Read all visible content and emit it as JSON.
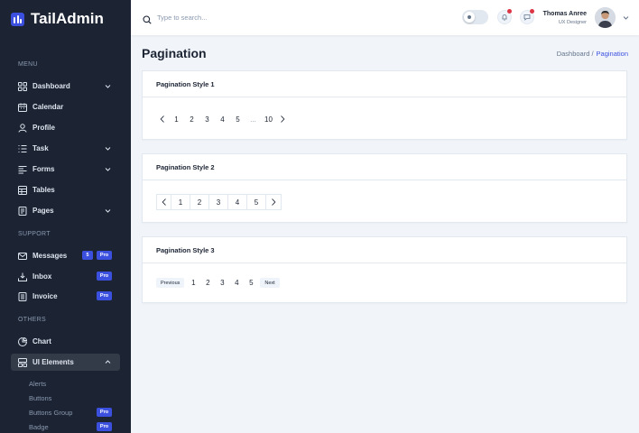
{
  "brand": {
    "name": "TailAdmin"
  },
  "sidebar": {
    "menu_label": "MENU",
    "support_label": "SUPPORT",
    "others_label": "OTHERS",
    "menu_items": [
      {
        "label": "Dashboard",
        "icon": "grid-icon",
        "has_chevron": true
      },
      {
        "label": "Calendar",
        "icon": "calendar-icon"
      },
      {
        "label": "Profile",
        "icon": "user-icon"
      },
      {
        "label": "Task",
        "icon": "list-icon",
        "has_chevron": true
      },
      {
        "label": "Forms",
        "icon": "form-icon",
        "has_chevron": true
      },
      {
        "label": "Tables",
        "icon": "table-icon"
      },
      {
        "label": "Pages",
        "icon": "page-icon",
        "has_chevron": true
      }
    ],
    "support_items": [
      {
        "label": "Messages",
        "icon": "mail-icon",
        "count": "5",
        "badge": "Pro"
      },
      {
        "label": "Inbox",
        "icon": "inbox-icon",
        "badge": "Pro"
      },
      {
        "label": "Invoice",
        "icon": "invoice-icon",
        "badge": "Pro"
      }
    ],
    "other_items": [
      {
        "label": "Chart",
        "icon": "pie-chart-icon"
      },
      {
        "label": "UI Elements",
        "icon": "layout-icon",
        "expanded": true
      }
    ],
    "ui_subitems": [
      {
        "label": "Alerts"
      },
      {
        "label": "Buttons"
      },
      {
        "label": "Buttons Group",
        "badge": "Pro"
      },
      {
        "label": "Badge",
        "badge": "Pro"
      }
    ]
  },
  "header": {
    "search_placeholder": "Type to search...",
    "user_name": "Thomas Anree",
    "user_role": "UX Designer"
  },
  "page": {
    "title": "Pagination",
    "breadcrumb_parent": "Dashboard /",
    "breadcrumb_current": "Pagination"
  },
  "cards": [
    {
      "title": "Pagination Style 1",
      "pages": [
        "1",
        "2",
        "3",
        "4",
        "5"
      ],
      "ellipsis": "...",
      "last_page": "10"
    },
    {
      "title": "Pagination Style 2",
      "pages": [
        "1",
        "2",
        "3",
        "4",
        "5"
      ]
    },
    {
      "title": "Pagination Style 3",
      "pages": [
        "1",
        "2",
        "3",
        "4",
        "5"
      ],
      "prev_label": "Previous",
      "next_label": "Next"
    }
  ],
  "colors": {
    "sidebar_bg": "#1c2434",
    "accent": "#3c50e0",
    "page_bg": "#f1f5f9",
    "notification_dot": "#dc3545"
  }
}
